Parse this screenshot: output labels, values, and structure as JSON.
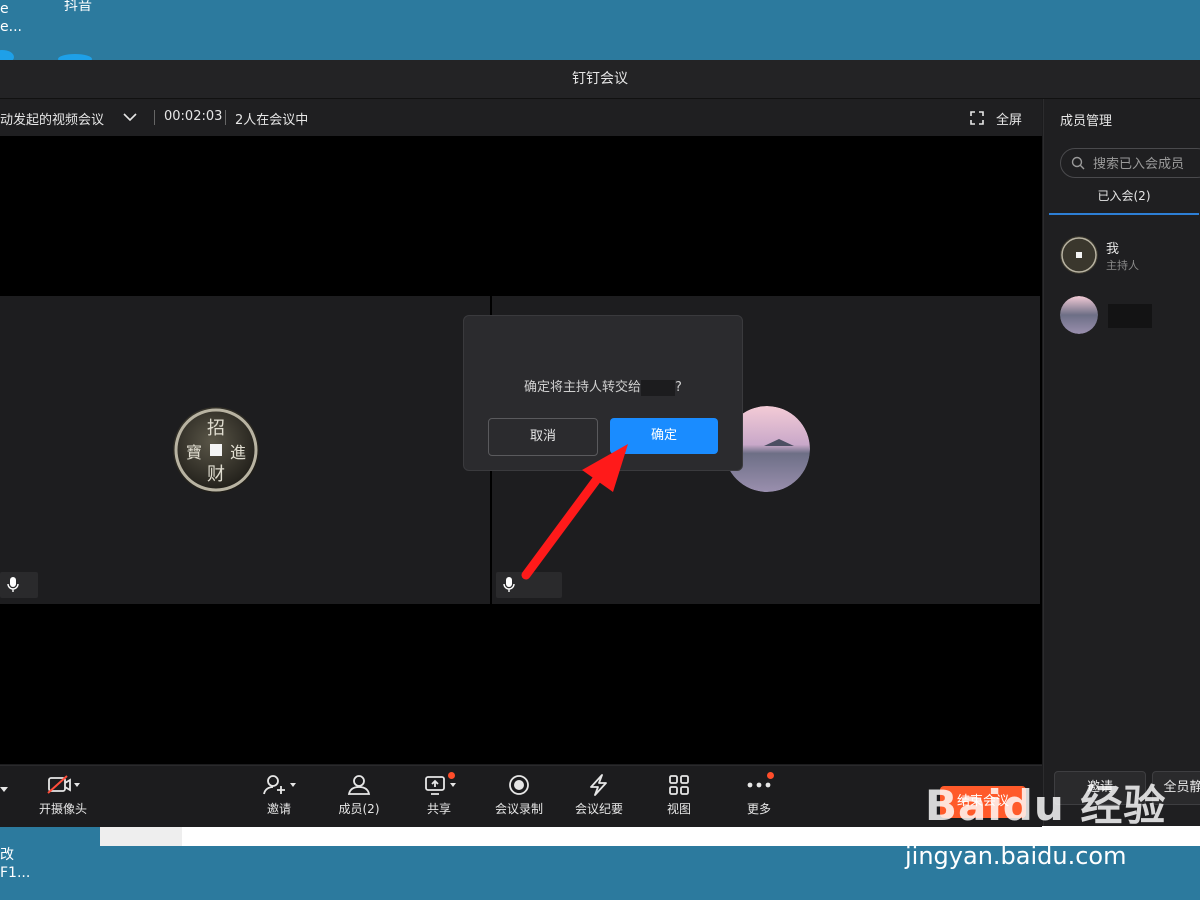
{
  "desktop": {
    "icon1_label_line1": "e",
    "icon1_label_line2": "e...",
    "icon2_label": "抖音",
    "icon3_label_line1": "改",
    "icon3_label_line2": "F1..."
  },
  "window": {
    "title": "钉钉会议"
  },
  "meeting_bar": {
    "meeting_name": "动发起的视频会议",
    "duration": "00:02:03",
    "participants_status": "2人在会议中",
    "fullscreen_label": "全屏"
  },
  "dialog": {
    "message_prefix": "确定将主持人转交给",
    "message_suffix": "?",
    "cancel_label": "取消",
    "confirm_label": "确定"
  },
  "toolbar": {
    "camera_label": "开摄像头",
    "invite_label": "邀请",
    "members_label": "成员(2)",
    "share_label": "共享",
    "record_label": "会议录制",
    "minutes_label": "会议纪要",
    "view_label": "视图",
    "more_label": "更多",
    "end_label": "结束会议"
  },
  "panel": {
    "title": "成员管理",
    "search_placeholder": "搜索已入会成员",
    "tab_joined": "已入会(2)",
    "members": [
      {
        "name": "我",
        "role": "主持人"
      },
      {
        "name": "",
        "role": ""
      }
    ],
    "invite_button": "邀请",
    "mute_all_button": "全员静"
  },
  "watermark": {
    "logo_text": "Baidu 经验",
    "url": "jingyan.baidu.com"
  },
  "colors": {
    "accent_blue": "#1a8cff",
    "end_red": "#ff5a2a",
    "annotation_arrow": "#ff1a1a",
    "desktop_bg": "#2c7a9e"
  }
}
